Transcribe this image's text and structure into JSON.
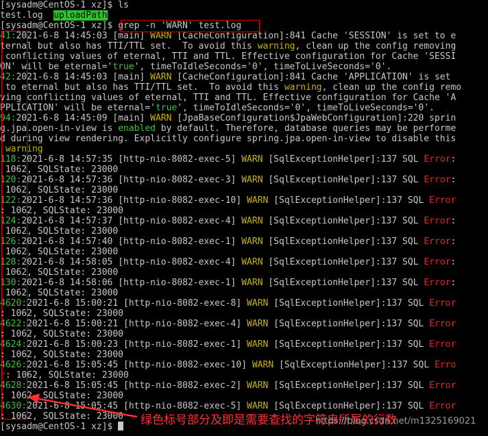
{
  "terminal": {
    "prompt": "[sysadm@CentOS-1 xz]$ ",
    "cmd_ls": "ls",
    "ls_out": {
      "file": "test.log",
      "dir": "uploadPath"
    },
    "cmd_grep": "grep -n 'WARN' test.log",
    "lines": [
      [
        [
          "g",
          "41:"
        ],
        [
          "n",
          "2021-6-8 14:45:03 [main] "
        ],
        [
          "y",
          "WARN"
        ],
        [
          "n",
          " [CacheConfiguration]:841 Cache 'SESSION' is set to e"
        ]
      ],
      [
        [
          "n",
          "ternal but also has TTI/TTL set.  To avoid this "
        ],
        [
          "y",
          "warning"
        ],
        [
          "n",
          ", clean up the config removing"
        ]
      ],
      [
        [
          "n",
          " conflicting values of eternal, TTI and TTL. Effective configuration for Cache 'SESSI"
        ]
      ],
      [
        [
          "n",
          "ON' will be eternal='"
        ],
        [
          "g",
          "true"
        ],
        [
          "n",
          "', timeToIdleSeconds='0', timeToLiveSeconds='0'."
        ]
      ],
      [
        [
          "g",
          "42:"
        ],
        [
          "n",
          "2021-6-8 14:45:03 [main] "
        ],
        [
          "y",
          "WARN"
        ],
        [
          "n",
          " [CacheConfiguration]:841 Cache 'APPLICATION' is set"
        ]
      ],
      [
        [
          "n",
          " to eternal but also has TTI/TTL set.  To avoid this "
        ],
        [
          "y",
          "warning"
        ],
        [
          "n",
          ", clean up the config remo"
        ]
      ],
      [
        [
          "n",
          "ving conflicting values of eternal, TTI and TTL. Effective configuration for Cache 'A"
        ]
      ],
      [
        [
          "n",
          "PPLICATION' will be eternal='"
        ],
        [
          "g",
          "true"
        ],
        [
          "n",
          "', timeToIdleSeconds='0', timeToLiveSeconds='0'."
        ]
      ],
      [
        [
          "g",
          "94:"
        ],
        [
          "n",
          "2021-6-8 14:45:09 [main] "
        ],
        [
          "y",
          "WARN"
        ],
        [
          "n",
          " [JpaBaseConfiguration$JpaWebConfiguration]:220 sprin"
        ]
      ],
      [
        [
          "n",
          "g.jpa.open-in-view is "
        ],
        [
          "g",
          "enabled"
        ],
        [
          "n",
          " by default. Therefore, database queries may be performe"
        ]
      ],
      [
        [
          "n",
          "d during view rendering. Explicitly configure spring.jpa.open-in-view to disable this"
        ]
      ],
      [
        [
          "y",
          " warning"
        ]
      ],
      [
        [
          "g",
          "118:"
        ],
        [
          "n",
          "2021-6-8 14:57:35 [http-nio-8082-exec-5] "
        ],
        [
          "y",
          "WARN"
        ],
        [
          "n",
          " [SqlExceptionHelper]:137 SQL "
        ],
        [
          "r",
          "Error"
        ],
        [
          "n",
          ":"
        ]
      ],
      [
        [
          "n",
          " 1062, SQLState: 23000"
        ]
      ],
      [
        [
          "g",
          "120:"
        ],
        [
          "n",
          "2021-6-8 14:57:36 [http-nio-8082-exec-3] "
        ],
        [
          "y",
          "WARN"
        ],
        [
          "n",
          " [SqlExceptionHelper]:137 SQL "
        ],
        [
          "r",
          "Error"
        ],
        [
          "n",
          ":"
        ]
      ],
      [
        [
          "n",
          " 1062, SQLState: 23000"
        ]
      ],
      [
        [
          "g",
          "122:"
        ],
        [
          "n",
          "2021-6-8 14:57:36 [http-nio-8082-exec-10] "
        ],
        [
          "y",
          "WARN"
        ],
        [
          "n",
          " [SqlExceptionHelper]:137 SQL "
        ],
        [
          "r",
          "Error"
        ]
      ],
      [
        [
          "n",
          ": 1062, SQLState: 23000"
        ]
      ],
      [
        [
          "g",
          "124:"
        ],
        [
          "n",
          "2021-6-8 14:57:37 [http-nio-8082-exec-4] "
        ],
        [
          "y",
          "WARN"
        ],
        [
          "n",
          " [SqlExceptionHelper]:137 SQL "
        ],
        [
          "r",
          "Error"
        ],
        [
          "n",
          ":"
        ]
      ],
      [
        [
          "n",
          " 1062, SQLState: 23000"
        ]
      ],
      [
        [
          "g",
          "126:"
        ],
        [
          "n",
          "2021-6-8 14:57:40 [http-nio-8082-exec-1] "
        ],
        [
          "y",
          "WARN"
        ],
        [
          "n",
          " [SqlExceptionHelper]:137 SQL "
        ],
        [
          "r",
          "Error"
        ],
        [
          "n",
          ":"
        ]
      ],
      [
        [
          "n",
          " 1062, SQLState: 23000"
        ]
      ],
      [
        [
          "g",
          "128:"
        ],
        [
          "n",
          "2021-6-8 14:58:05 [http-nio-8082-exec-4] "
        ],
        [
          "y",
          "WARN"
        ],
        [
          "n",
          " [SqlExceptionHelper]:137 SQL "
        ],
        [
          "r",
          "Error"
        ],
        [
          "n",
          ":"
        ]
      ],
      [
        [
          "n",
          " 1062, SQLState: 23000"
        ]
      ],
      [
        [
          "g",
          "130:"
        ],
        [
          "n",
          "2021-6-8 14:58:06 [http-nio-8082-exec-1] "
        ],
        [
          "y",
          "WARN"
        ],
        [
          "n",
          " [SqlExceptionHelper]:137 SQL "
        ],
        [
          "r",
          "Error"
        ],
        [
          "n",
          ":"
        ]
      ],
      [
        [
          "n",
          " 1062, SQLState: 23000"
        ]
      ],
      [
        [
          "g",
          "4620:"
        ],
        [
          "n",
          "2021-6-8 15:00:21 [http-nio-8082-exec-8] "
        ],
        [
          "y",
          "WARN"
        ],
        [
          "n",
          " [SqlExceptionHelper]:137 SQL "
        ],
        [
          "r",
          "Error"
        ]
      ],
      [
        [
          "n",
          ": 1062, SQLState: 23000"
        ]
      ],
      [
        [
          "g",
          "4622:"
        ],
        [
          "n",
          "2021-6-8 15:00:21 [http-nio-8082-exec-4] "
        ],
        [
          "y",
          "WARN"
        ],
        [
          "n",
          " [SqlExceptionHelper]:137 SQL "
        ],
        [
          "r",
          "Error"
        ]
      ],
      [
        [
          "n",
          ": 1062, SQLState: 23000"
        ]
      ],
      [
        [
          "g",
          "4624:"
        ],
        [
          "n",
          "2021-6-8 15:00:23 [http-nio-8082-exec-1] "
        ],
        [
          "y",
          "WARN"
        ],
        [
          "n",
          " [SqlExceptionHelper]:137 SQL "
        ],
        [
          "r",
          "Error"
        ]
      ],
      [
        [
          "n",
          ": 1062, SQLState: 23000"
        ]
      ],
      [
        [
          "g",
          "4626:"
        ],
        [
          "n",
          "2021-6-8 15:05:45 [http-nio-8082-exec-10] "
        ],
        [
          "y",
          "WARN"
        ],
        [
          "n",
          " [SqlExceptionHelper]:137 SQL "
        ],
        [
          "r",
          "Erro"
        ]
      ],
      [
        [
          "r",
          "r"
        ],
        [
          "n",
          ": 1062, SQLState: 23000"
        ]
      ],
      [
        [
          "g",
          "4628:"
        ],
        [
          "n",
          "2021-6-8 15:05:45 [http-nio-8082-exec-2] "
        ],
        [
          "y",
          "WARN"
        ],
        [
          "n",
          " [SqlExceptionHelper]:137 SQL "
        ],
        [
          "r",
          "Error"
        ]
      ],
      [
        [
          "n",
          ": 1062, SQLState: 23000"
        ]
      ],
      [
        [
          "g",
          "4630:"
        ],
        [
          "n",
          "2021-6-8 15:05:45 [http-nio-8082-exec-5] "
        ],
        [
          "y",
          "WARN"
        ],
        [
          "n",
          " [SqlExceptionHelper]:137 SQL "
        ],
        [
          "r",
          "Error"
        ]
      ],
      [
        [
          "n",
          ": 1062, SQLState: 23000"
        ]
      ]
    ]
  },
  "annotation": {
    "text": "绿色标号部分及即是需要查找的字符串所属的行数",
    "watermark": "https://blog.csdn.net/m1325169021"
  },
  "colors": {
    "green": "#3cc33c",
    "yellow": "#c8b400",
    "red": "#e02828",
    "annotation": "#ff3030"
  }
}
